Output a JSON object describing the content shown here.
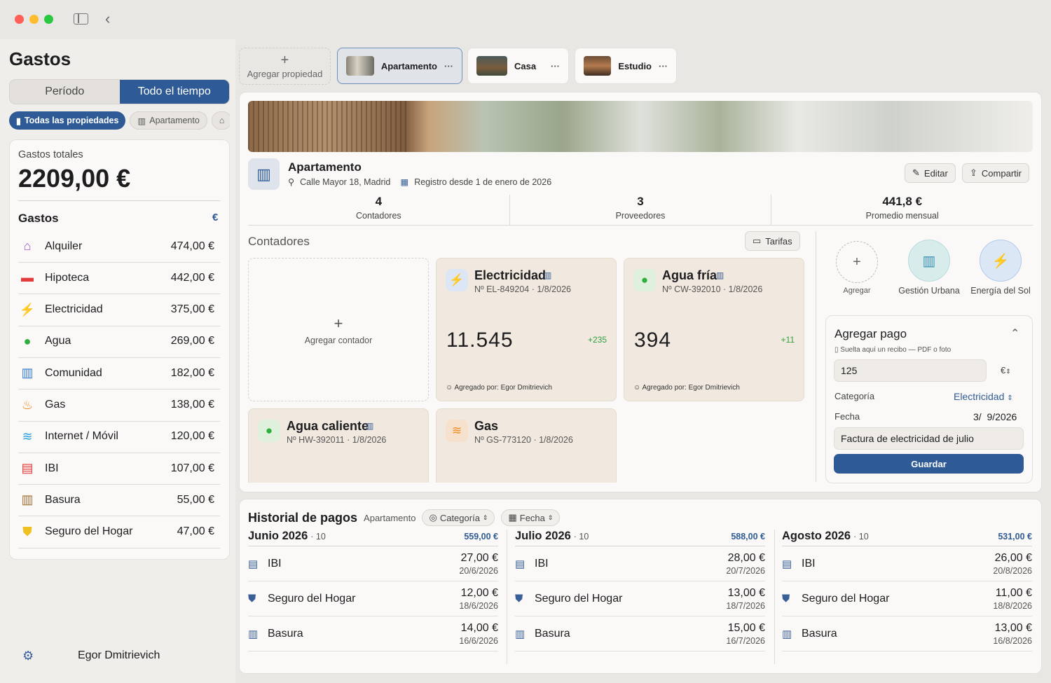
{
  "sidebar": {
    "title": "Gastos",
    "segments": [
      "Período",
      "Todo el tiempo"
    ],
    "chips": [
      "Todas las propiedades",
      "Apartamento"
    ],
    "total_label": "Gastos totales",
    "total_value": "2209,00 €",
    "list_title": "Gastos",
    "currency_symbol": "€",
    "items": [
      {
        "name": "Alquiler",
        "value": "474,00 €",
        "icon": "house-icon",
        "color": "#9b59d0"
      },
      {
        "name": "Hipoteca",
        "value": "442,00 €",
        "icon": "banknote-icon",
        "color": "#e23b3b"
      },
      {
        "name": "Electricidad",
        "value": "375,00 €",
        "icon": "bolt-icon",
        "color": "#2f7de1"
      },
      {
        "name": "Agua",
        "value": "269,00 €",
        "icon": "drop-icon",
        "color": "#2fae3f"
      },
      {
        "name": "Comunidad",
        "value": "182,00 €",
        "icon": "building-icon",
        "color": "#3a7fd0"
      },
      {
        "name": "Gas",
        "value": "138,00 €",
        "icon": "flame-icon",
        "color": "#f08a1c"
      },
      {
        "name": "Internet / Móvil",
        "value": "120,00 €",
        "icon": "wifi-icon",
        "color": "#2a9fe0"
      },
      {
        "name": "IBI",
        "value": "107,00 €",
        "icon": "document-icon",
        "color": "#e23b3b"
      },
      {
        "name": "Basura",
        "value": "55,00 €",
        "icon": "trash-icon",
        "color": "#a0743c"
      },
      {
        "name": "Seguro del Hogar",
        "value": "47,00 €",
        "icon": "shield-icon",
        "color": "#f0c020"
      }
    ],
    "user": "Egor Dmitrievich"
  },
  "tabs": {
    "add_label": "Agregar propiedad",
    "items": [
      {
        "label": "Apartamento"
      },
      {
        "label": "Casa"
      },
      {
        "label": "Estudio"
      }
    ],
    "more": "···"
  },
  "property": {
    "name": "Apartamento",
    "address": "Calle Mayor 18, Madrid",
    "since": "Registro desde 1 de enero de 2026",
    "edit": "Editar",
    "share": "Compartir",
    "stats": [
      {
        "value": "4",
        "label": "Contadores"
      },
      {
        "value": "3",
        "label": "Proveedores"
      },
      {
        "value": "441,8 €",
        "label": "Promedio mensual"
      }
    ]
  },
  "meters": {
    "title": "Contadores",
    "tariffs": "Tarifas",
    "add": "Agregar contador",
    "items": [
      {
        "name": "Electricidad",
        "sub": "Nº EL-849204 · 1/8/2026",
        "value": "11.545",
        "delta": "+235",
        "added": "Agregado por: Egor Dmitrievich"
      },
      {
        "name": "Agua fría",
        "sub": "Nº CW-392010 · 1/8/2026",
        "value": "394",
        "delta": "+11",
        "added": "Agregado por: Egor Dmitrievich"
      },
      {
        "name": "Agua caliente",
        "sub": "Nº HW-392011 · 1/8/2026"
      },
      {
        "name": "Gas",
        "sub": "Nº GS-773120 · 1/8/2026"
      }
    ]
  },
  "providers": {
    "add": "Agregar",
    "items": [
      "Gestión Urbana",
      "Energía del Sol"
    ]
  },
  "payment": {
    "title": "Agregar pago",
    "drop_hint": "Suelta aquí un recibo — PDF o foto",
    "amount": "125",
    "currency": "€",
    "category_label": "Categoría",
    "category_value": "Electricidad",
    "date_label": "Fecha",
    "date_value": "3/  9/2026",
    "note": "Factura de electricidad de julio",
    "save": "Guardar"
  },
  "history": {
    "title": "Historial de pagos",
    "property": "Apartamento",
    "filter_category": "Categoría",
    "filter_date": "Fecha",
    "months": [
      {
        "month": "Junio 2026",
        "count": "· 10",
        "total": "559,00 €",
        "rows": [
          {
            "name": "IBI",
            "amount": "27,00 €",
            "date": "20/6/2026",
            "icon": "document-icon"
          },
          {
            "name": "Seguro del Hogar",
            "amount": "12,00 €",
            "date": "18/6/2026",
            "icon": "shield-icon"
          },
          {
            "name": "Basura",
            "amount": "14,00 €",
            "date": "16/6/2026",
            "icon": "trash-icon"
          }
        ]
      },
      {
        "month": "Julio 2026",
        "count": "· 10",
        "total": "588,00 €",
        "rows": [
          {
            "name": "IBI",
            "amount": "28,00 €",
            "date": "20/7/2026",
            "icon": "document-icon"
          },
          {
            "name": "Seguro del Hogar",
            "amount": "13,00 €",
            "date": "18/7/2026",
            "icon": "shield-icon"
          },
          {
            "name": "Basura",
            "amount": "15,00 €",
            "date": "16/7/2026",
            "icon": "trash-icon"
          }
        ]
      },
      {
        "month": "Agosto 2026",
        "count": "· 10",
        "total": "531,00 €",
        "rows": [
          {
            "name": "IBI",
            "amount": "26,00 €",
            "date": "20/8/2026",
            "icon": "document-icon"
          },
          {
            "name": "Seguro del Hogar",
            "amount": "11,00 €",
            "date": "18/8/2026",
            "icon": "shield-icon"
          },
          {
            "name": "Basura",
            "amount": "13,00 €",
            "date": "16/8/2026",
            "icon": "trash-icon"
          }
        ]
      }
    ]
  },
  "colors": {
    "accent": "#2e5b95",
    "positive": "#2f9f3f"
  }
}
